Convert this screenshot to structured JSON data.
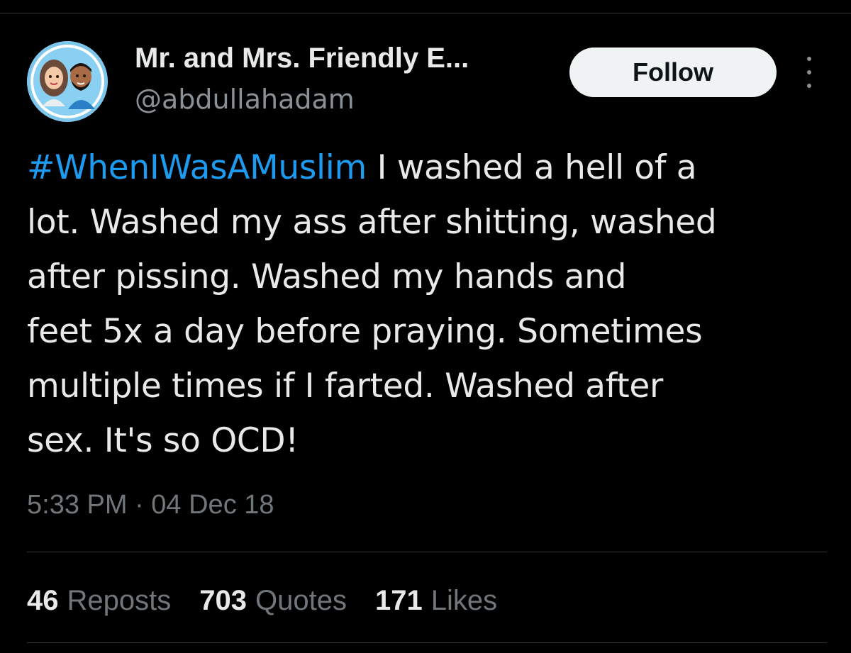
{
  "author": {
    "display_name": "Mr. and Mrs. Friendly E...",
    "handle": "@abdullahadam",
    "avatar_icon": "couple-cartoon-avatar"
  },
  "follow_button": {
    "label": "Follow"
  },
  "more_menu": {
    "icon": "vertical-ellipsis-icon"
  },
  "tweet": {
    "lines": [
      {
        "hashtag": "#WhenIWasAMuslim",
        "text": " I washed a hell of a"
      },
      {
        "text": "lot. Washed my ass after shitting, washed"
      },
      {
        "text": "after pissing. Washed my hands and"
      },
      {
        "text": "feet 5x a day before praying. Sometimes"
      },
      {
        "text": "multiple times if I farted. Washed after"
      },
      {
        "text": "sex. It's so OCD!"
      }
    ],
    "timestamp": "5:33 PM · 04 Dec 18"
  },
  "stats": {
    "reposts_count": "46",
    "reposts_label": "Reposts",
    "quotes_count": "703",
    "quotes_label": "Quotes",
    "likes_count": "171",
    "likes_label": "Likes"
  },
  "colors": {
    "background": "#000000",
    "primary_text": "#e7e9ea",
    "secondary_text": "#71767b",
    "hashtag": "#1d9bf0",
    "button_bg": "#eff3f4",
    "divider": "#2f3336"
  }
}
